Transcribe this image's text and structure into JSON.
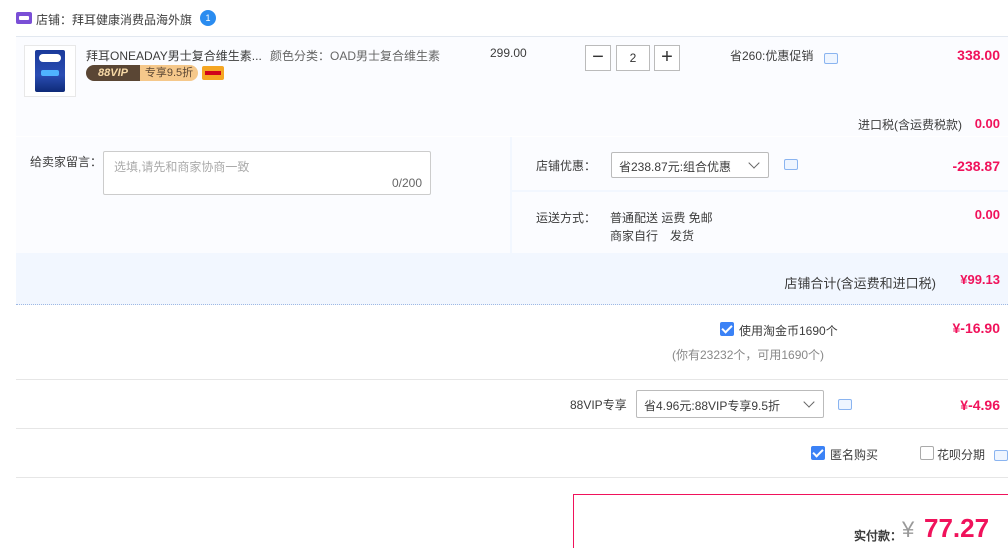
{
  "shop": {
    "label": "店铺：拜耳健康消费品海外旗",
    "badge": "1"
  },
  "item": {
    "title": "拜耳ONEADAY男士复合维生素...",
    "vip_badge_left": "88VIP",
    "vip_badge_right": "专享9.5折",
    "sku": "颜色分类：OAD男士复合维生素",
    "unit_price": "299.00",
    "qty_minus": "−",
    "qty_value": "2",
    "qty_plus": "+",
    "promo": "省260:优惠促销",
    "total": "338.00",
    "tax_label": "进口税(含运费税款)",
    "tax_value": "0.00"
  },
  "extras": {
    "msg_label": "给卖家留言：",
    "msg_placeholder": "选填,请先和商家协商一致",
    "msg_count": "0/200",
    "discount_label": "店铺优惠：",
    "discount_select": "省238.87元:组合优惠",
    "discount_value": "-238.87",
    "ship_label": "运送方式：",
    "ship_line1": "普通配送 运费 免邮",
    "ship_line2": "商家自行　发货",
    "ship_value": "0.00",
    "shop_total_label": "店铺合计(含运费和进口税)",
    "shop_total_value": "¥99.13"
  },
  "coins": {
    "label": "使用淘金币1690个",
    "sub": "(你有23232个，可用1690个)",
    "value": "¥-16.90",
    "checked": true
  },
  "vip": {
    "label": "88VIP专享",
    "select": "省4.96元:88VIP专享9.5折",
    "value": "¥-4.96"
  },
  "options": {
    "anonymous_label": "匿名购买",
    "anonymous_checked": true,
    "huabei_label": "花呗分期",
    "huabei_checked": false
  },
  "pay": {
    "label": "实付款：",
    "currency": "¥",
    "amount": "77.27"
  },
  "colors": {
    "accent_red": "#f0125b",
    "check_blue": "#3b82f6",
    "panel_bg": "#f2f7ff"
  }
}
